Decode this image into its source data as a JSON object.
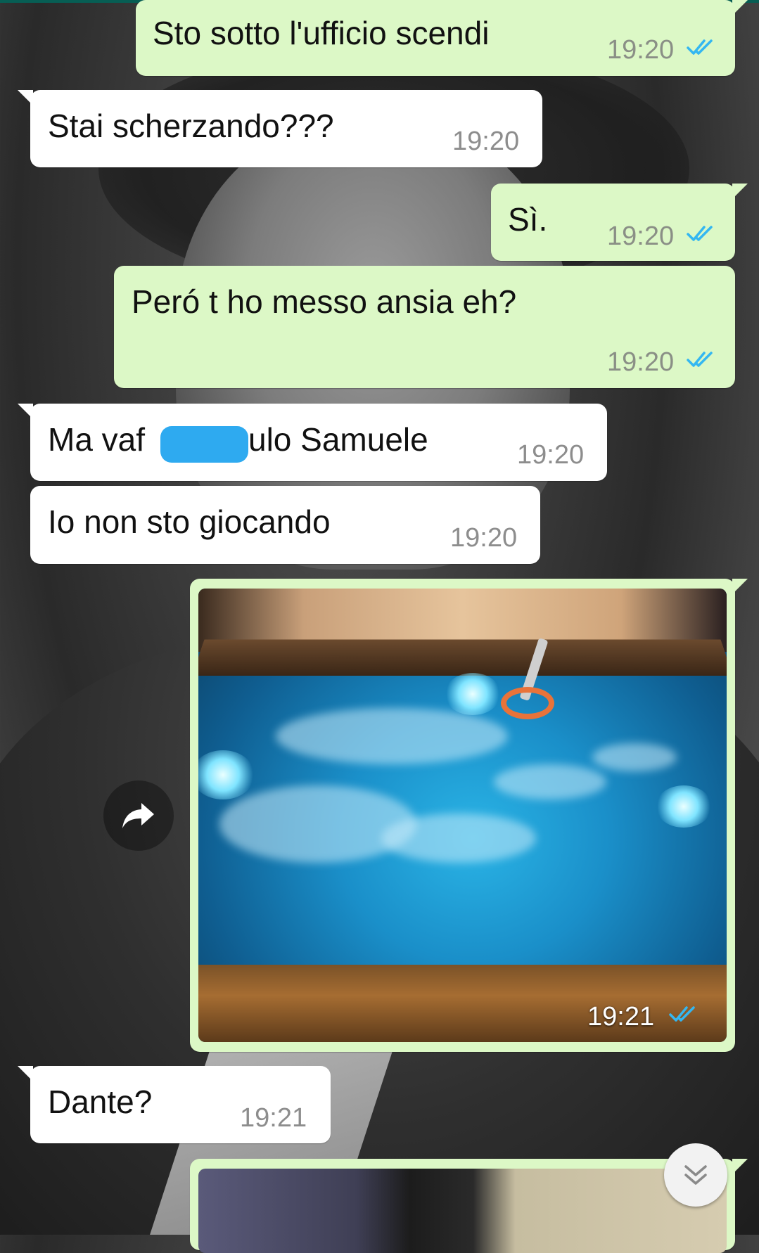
{
  "colors": {
    "outgoing_bubble": "#dcf8c6",
    "incoming_bubble": "#ffffff",
    "read_ticks": "#34b7f1",
    "redaction": "#2eaaf0"
  },
  "messages": [
    {
      "direction": "outgoing",
      "text": "Sto sotto l'ufficio scendi",
      "time": "19:20",
      "status": "read"
    },
    {
      "direction": "incoming",
      "text": "Stai scherzando???",
      "time": "19:20"
    },
    {
      "direction": "outgoing",
      "text": "Sì.",
      "time": "19:20",
      "status": "read"
    },
    {
      "direction": "outgoing",
      "text": "Peró t ho messo ansia eh?",
      "time": "19:20",
      "status": "read"
    },
    {
      "direction": "incoming",
      "text_before": "Ma vaf",
      "text_after": "ulo Samuele",
      "redacted": true,
      "time": "19:20"
    },
    {
      "direction": "incoming",
      "text": "Io non sto giocando",
      "time": "19:20"
    },
    {
      "direction": "outgoing",
      "type": "image",
      "image": "hot-tub-photo",
      "time": "19:21",
      "status": "read"
    },
    {
      "direction": "incoming",
      "text": "Dante?",
      "time": "19:21"
    },
    {
      "direction": "outgoing",
      "type": "image",
      "image": "mosaic-wall-photo"
    }
  ],
  "icons": {
    "forward": "forward-arrow-icon",
    "scroll_down": "double-chevron-down-icon",
    "read_receipt": "double-check-icon"
  }
}
